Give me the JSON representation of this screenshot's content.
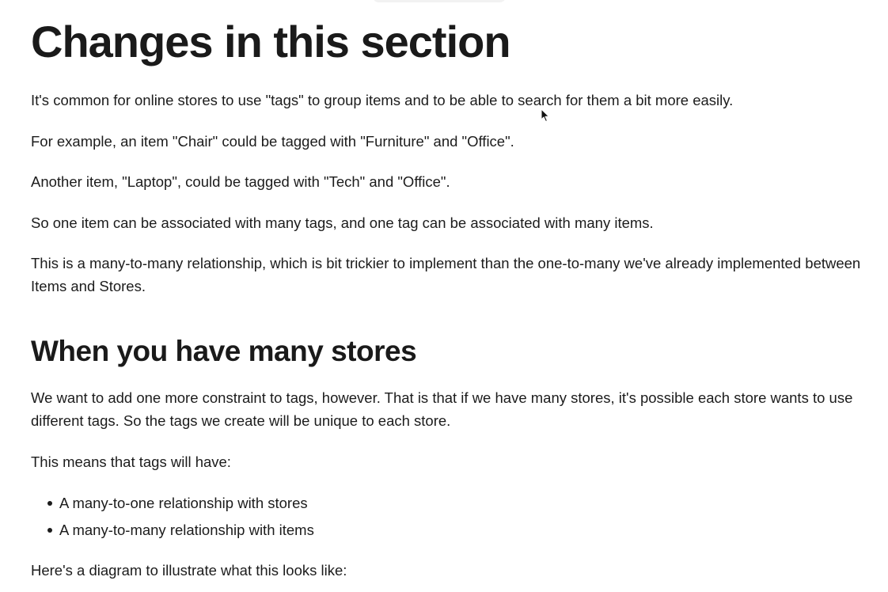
{
  "heading_main": "Changes in this section",
  "paragraphs_intro": [
    "It's common for online stores to use \"tags\" to group items and to be able to search for them a bit more easily.",
    "For example, an item \"Chair\" could be tagged with \"Furniture\" and \"Office\".",
    "Another item, \"Laptop\", could be tagged with \"Tech\" and \"Office\".",
    "So one item can be associated with many tags, and one tag can be associated with many items.",
    "This is a many-to-many relationship, which is bit trickier to implement than the one-to-many we've already implemented between Items and Stores."
  ],
  "heading_stores": "When you have many stores",
  "paragraph_constraint": "We want to add one more constraint to tags, however. That is that if we have many stores, it's possible each store wants to use different tags. So the tags we create will be unique to each store.",
  "paragraph_means": "This means that tags will have:",
  "list_items": [
    "A many-to-one relationship with stores",
    "A many-to-many relationship with items"
  ],
  "paragraph_diagram": "Here's a diagram to illustrate what this looks like:",
  "icons": {
    "cursor": "mouse-pointer-icon"
  }
}
